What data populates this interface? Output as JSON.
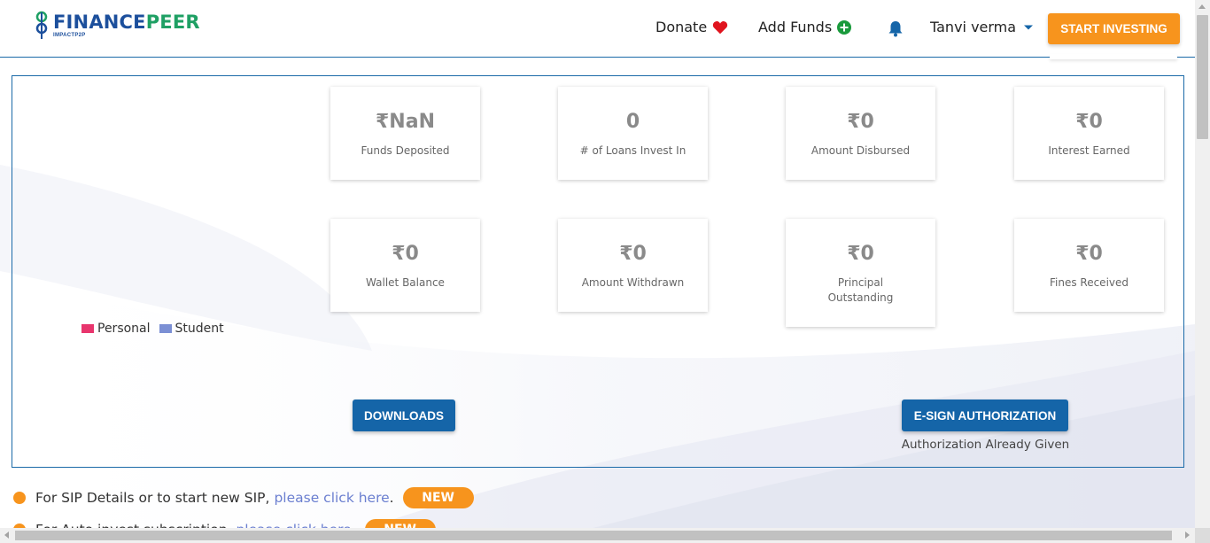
{
  "brand": {
    "name_part1": "FINANCE",
    "name_part2": "PEER",
    "tagline": "IMPACTP2P",
    "primary_color": "#1c4f9c",
    "secondary_color": "#1fa064"
  },
  "nav": {
    "donate_label": "Donate",
    "add_funds_label": "Add Funds",
    "user_name": "Tanvi verma",
    "start_investing_label": "START INVESTING"
  },
  "legend": {
    "items": [
      {
        "label": "Personal",
        "color": "#e8356d"
      },
      {
        "label": "Student",
        "color": "#7b8fd4"
      }
    ]
  },
  "stats": [
    {
      "value": "₹NaN",
      "label": "Funds Deposited"
    },
    {
      "value": "0",
      "label": "# of Loans Invest In"
    },
    {
      "value": "₹0",
      "label": "Amount Disbursed"
    },
    {
      "value": "₹0",
      "label": "Interest Earned"
    },
    {
      "value": "₹0",
      "label": "Wallet Balance"
    },
    {
      "value": "₹0",
      "label": "Amount Withdrawn"
    },
    {
      "value": "₹0",
      "label": "Principal Outstanding"
    },
    {
      "value": "₹0",
      "label": "Fines Received"
    }
  ],
  "actions": {
    "downloads_label": "DOWNLOADS",
    "esign_label": "E-SIGN AUTHORIZATION",
    "esign_status": "Authorization Already Given"
  },
  "info_lines": [
    {
      "text": "For SIP Details or to start new SIP,",
      "link": "please click here",
      "suffix": ".",
      "badge": "NEW"
    },
    {
      "text": "For Auto invest subscription,",
      "link": "please click here",
      "suffix": ".",
      "badge": "NEW"
    }
  ],
  "colors": {
    "accent_orange": "#f7941d",
    "button_blue": "#1565a8",
    "heart_red": "#e0141e",
    "plus_green": "#1a9a3c",
    "bell_blue": "#1565a8"
  }
}
